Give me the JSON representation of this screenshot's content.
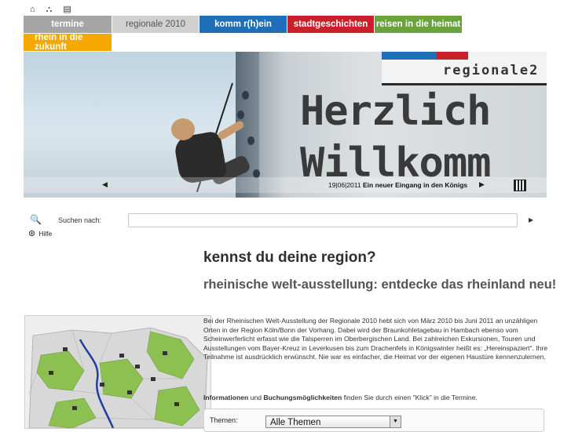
{
  "top_icons": [
    {
      "name": "home-icon",
      "glyph": "⌂"
    },
    {
      "name": "sitemap-icon",
      "glyph": "⛬"
    },
    {
      "name": "print-icon",
      "glyph": "▤"
    }
  ],
  "nav": {
    "tabs": [
      {
        "label": "termine",
        "color": "#a5a5a5"
      },
      {
        "label": "regionale 2010",
        "color": "#d0d0d0"
      },
      {
        "label": "komm r(h)ein",
        "color": "#1e6fb8"
      },
      {
        "label": "stadtgeschichten",
        "color": "#c9202b"
      },
      {
        "label": "reisen in die heimat",
        "color": "#6aa33a"
      },
      {
        "label": "rhein in die zukunft",
        "color": "#f5a800"
      }
    ]
  },
  "hero": {
    "banner_brand": "regionale2",
    "wall_line1": "Herzlich",
    "wall_line2": "Willkomm",
    "prev_icon": "◀",
    "caption_date": "19|06|2011",
    "caption_title": "Ein neuer Eingang in den Königs",
    "next_icon": "▶"
  },
  "search": {
    "icon": "🔍",
    "label": "Suchen nach:",
    "value": "",
    "go_icon": "▶"
  },
  "help": {
    "icon": "⊛",
    "label": "Hilfe"
  },
  "main": {
    "title": "kennst du deine region?",
    "subtitle": "rheinische welt-ausstellung: entdecke das rheinland neu!",
    "body": "Bei der Rheinischen Welt-Ausstellung der Regionale 2010 hebt sich von März 2010 bis Juni 2011 an unzähligen Orten in der Region Köln/Bonn der Vorhang. Dabei wird der Braunkohletagebau in Hambach ebenso vom Scheinwerferlicht erfasst wie die Talsperren im Oberbergischen Land. Bei zahlreichen Exkursionen, Touren und Ausstellungen vom Bayer-Kreuz in Leverkusen bis zum Drachenfels in Königswinter heißt es: „Hereinspaziert“. Ihre Teilnahme ist ausdrücklich erwünscht. Nie war es einfacher, die Heimat vor der eigenen Haustüre kennenzulernen.",
    "info_bold1": "Informationen",
    "info_mid": " und ",
    "info_bold2": "Buchungsmöglichkeiten",
    "info_rest": " finden Sie durch einen \"Klick\" in die Termine."
  },
  "filter": {
    "label": "Themen:",
    "selected": "Alle Themen",
    "arrow": "▼"
  },
  "colors": {
    "map_green": "#8cc152",
    "map_river": "#1f3f9e",
    "map_gray": "#d8d8d8"
  }
}
